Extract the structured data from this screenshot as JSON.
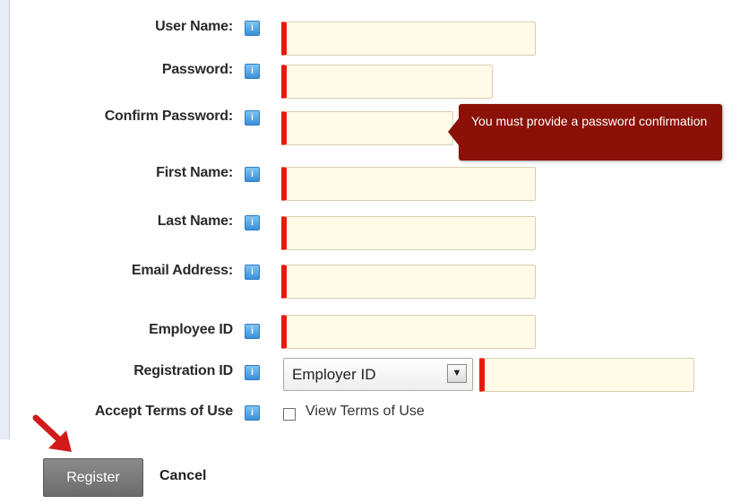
{
  "form": {
    "fields": [
      {
        "label": "User Name:"
      },
      {
        "label": "Password:"
      },
      {
        "label": "Confirm Password:"
      },
      {
        "label": "First Name:"
      },
      {
        "label": "Last Name:"
      },
      {
        "label": "Email Address:"
      },
      {
        "label": "Employee ID"
      },
      {
        "label": "Registration ID"
      },
      {
        "label": "Accept Terms of Use"
      }
    ],
    "help_icon": "info-icon",
    "help_glyph": "i",
    "tooltip": "You must provide a password confirmation",
    "registration_select": {
      "selected": "Employer ID",
      "arrow": "▼"
    },
    "terms_link": "View Terms of Use",
    "error_color": "#e8190f",
    "tooltip_color": "#8b1108"
  },
  "actions": {
    "register_label": "Register",
    "cancel_label": "Cancel"
  }
}
